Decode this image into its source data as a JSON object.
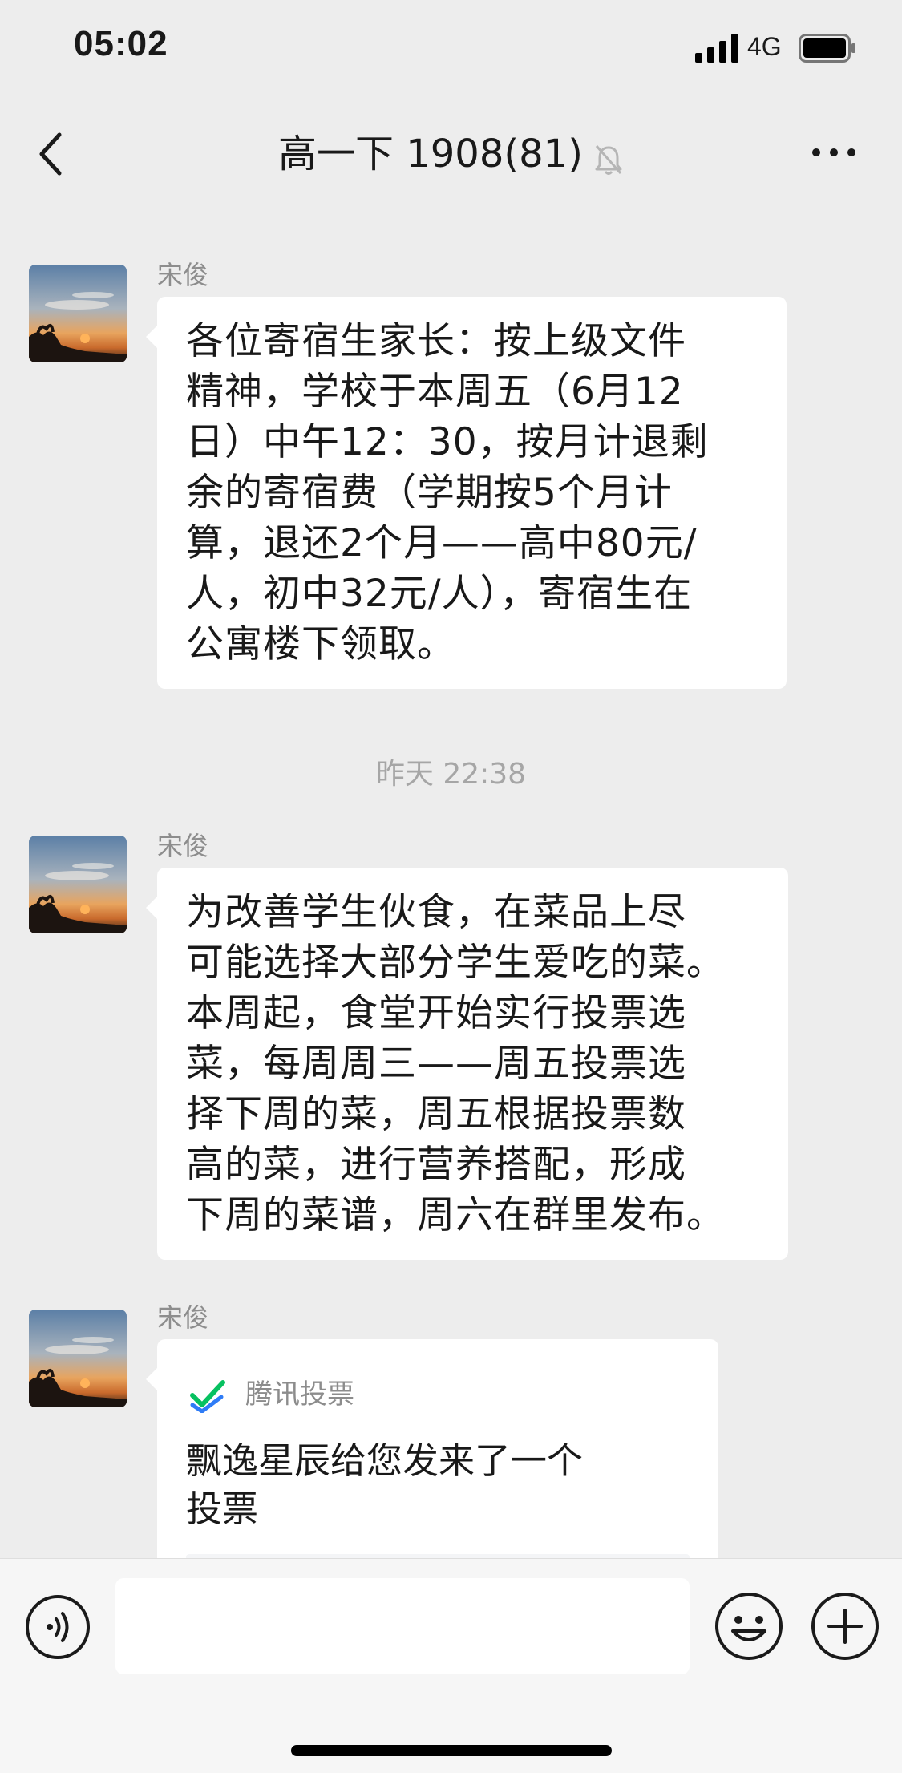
{
  "status_bar": {
    "time": "05:02",
    "network": "4G"
  },
  "header": {
    "title": "高一下 1908(81)",
    "muted_icon": "bell-slash-icon",
    "more_icon": "more-dots-icon",
    "back_icon": "chevron-left-icon"
  },
  "messages": [
    {
      "sender": "宋俊",
      "lines": [
        "各位寄宿生家长：按上级文件",
        "精神，学校于本周五（6月12",
        "日）中午12：30，按月计退剩",
        "余的寄宿费（学期按5个月计",
        "算，退还2个月——高中80元/",
        "人，初中32元/人），寄宿生在",
        "公寓楼下领取。"
      ]
    },
    {
      "timestamp": "昨天 22:38",
      "sender": "宋俊",
      "lines": [
        "为改善学生伙食，在菜品上尽",
        "可能选择大部分学生爱吃的菜。",
        "本周起，食堂开始实行投票选",
        "菜，每周周三——周五投票选",
        "择下周的菜，周五根据投票数",
        "高的菜，进行营养搭配，形成",
        "下周的菜谱，周六在群里发布。"
      ]
    },
    {
      "sender": "宋俊",
      "card": {
        "app_name": "腾讯投票",
        "lines": [
          "飘逸星辰给您发来了一个",
          "投票"
        ]
      }
    }
  ],
  "input_bar": {
    "voice_icon": "voice-icon",
    "input_value": "",
    "emoji_icon": "emoji-icon",
    "plus_icon": "plus-icon"
  },
  "colors": {
    "background": "#ededed",
    "bubble": "#ffffff",
    "timestamp": "#a6a6a6",
    "vote_green": "#07c160",
    "vote_blue": "#2f7cf6"
  }
}
